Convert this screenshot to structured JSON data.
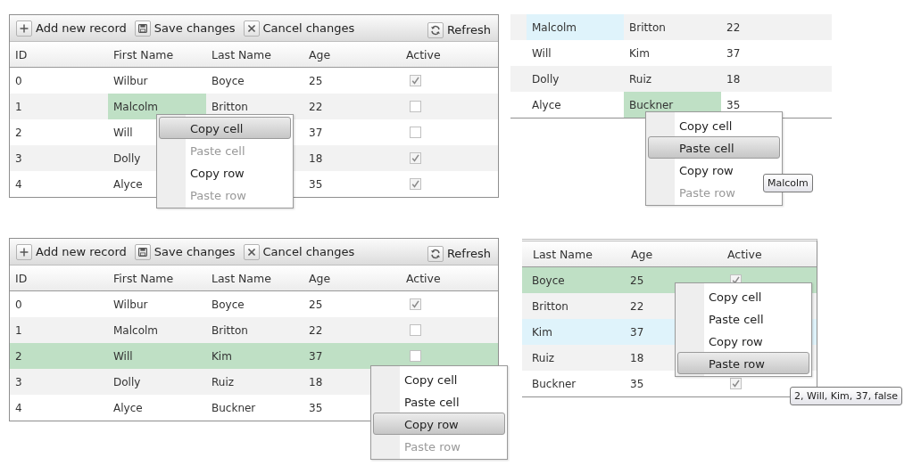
{
  "panels": [
    {
      "toolbar": [
        {
          "kind": "add",
          "label": "Add new record"
        },
        {
          "kind": "save",
          "label": "Save changes"
        },
        {
          "kind": "cancel",
          "label": "Cancel changes"
        },
        {
          "kind": "refresh",
          "label": "Refresh"
        }
      ],
      "columns": [
        "ID",
        "First Name",
        "Last Name",
        "Age",
        "Active"
      ],
      "rows": [
        {
          "selected": false,
          "id": "0",
          "first_name": "Wilbur",
          "last_name": "Boyce",
          "age": "25",
          "active": true
        },
        {
          "selected": false,
          "id": "1",
          "first_name": {
            "text": "Malcolm",
            "selected": true
          },
          "last_name": "Britton",
          "age": "22",
          "active": false
        },
        {
          "selected": false,
          "id": "2",
          "first_name": "Will",
          "age": "37",
          "active": false
        },
        {
          "selected": false,
          "id": "3",
          "first_name": "Dolly",
          "age": "18",
          "active": true
        },
        {
          "selected": false,
          "id": "4",
          "first_name": "Alyce",
          "age": "35",
          "active": true
        }
      ],
      "menu": {
        "items": [
          {
            "label": "Copy cell",
            "highlighted": true,
            "disabled": false
          },
          {
            "label": "Paste cell",
            "highlighted": false,
            "disabled": true
          },
          {
            "label": "Copy row",
            "highlighted": false,
            "disabled": false
          },
          {
            "label": "Paste row",
            "highlighted": false,
            "disabled": true
          }
        ]
      }
    },
    {
      "rows": [
        {
          "selected": false,
          "first_name": {
            "text": "Malcolm",
            "copied": true
          },
          "last_name": "Britton",
          "age": "22"
        },
        {
          "selected": false,
          "first_name": "Will",
          "last_name": "Kim",
          "age": "37"
        },
        {
          "selected": false,
          "first_name": "Dolly",
          "last_name": "Ruiz",
          "age": "18"
        },
        {
          "selected": false,
          "first_name": "Alyce",
          "last_name": {
            "text": "Buckner",
            "selected": true
          },
          "age": "35"
        }
      ],
      "menu": {
        "items": [
          {
            "label": "Copy cell",
            "highlighted": false,
            "disabled": false
          },
          {
            "label": "Paste cell",
            "highlighted": true,
            "disabled": false
          },
          {
            "label": "Copy row",
            "highlighted": false,
            "disabled": false
          },
          {
            "label": "Paste row",
            "highlighted": false,
            "disabled": true
          }
        ]
      },
      "tooltip": "Malcolm"
    },
    {
      "toolbar": [
        {
          "kind": "add",
          "label": "Add new record"
        },
        {
          "kind": "save",
          "label": "Save changes"
        },
        {
          "kind": "cancel",
          "label": "Cancel changes"
        },
        {
          "kind": "refresh",
          "label": "Refresh"
        }
      ],
      "columns": [
        "ID",
        "First Name",
        "Last Name",
        "Age",
        "Active"
      ],
      "rows": [
        {
          "selected": false,
          "id": "0",
          "first_name": "Wilbur",
          "last_name": "Boyce",
          "age": "25",
          "active": true
        },
        {
          "selected": false,
          "id": "1",
          "first_name": "Malcolm",
          "last_name": "Britton",
          "age": "22",
          "active": false
        },
        {
          "selected": true,
          "id": "2",
          "first_name": "Will",
          "last_name": "Kim",
          "age": "37",
          "active": false
        },
        {
          "selected": false,
          "id": "3",
          "first_name": "Dolly",
          "last_name": "Ruiz",
          "age": "18"
        },
        {
          "selected": false,
          "id": "4",
          "first_name": "Alyce",
          "last_name": "Buckner",
          "age": "35"
        }
      ],
      "menu": {
        "items": [
          {
            "label": "Copy cell",
            "highlighted": false,
            "disabled": false
          },
          {
            "label": "Paste cell",
            "highlighted": false,
            "disabled": false
          },
          {
            "label": "Copy row",
            "highlighted": true,
            "disabled": false
          },
          {
            "label": "Paste row",
            "highlighted": false,
            "disabled": true
          }
        ]
      }
    },
    {
      "columns": [
        "Last Name",
        "Age",
        "Active"
      ],
      "rows": [
        {
          "selected": true,
          "copied": false,
          "last_name": "Boyce",
          "age": "25",
          "active": true
        },
        {
          "selected": false,
          "copied": false,
          "last_name": "Britton",
          "age": "22"
        },
        {
          "selected": false,
          "copied": true,
          "last_name": "Kim",
          "age": "37"
        },
        {
          "selected": false,
          "copied": false,
          "last_name": "Ruiz",
          "age": "18"
        },
        {
          "selected": false,
          "copied": false,
          "last_name": "Buckner",
          "age": "35",
          "active": true
        }
      ],
      "menu": {
        "items": [
          {
            "label": "Copy cell",
            "highlighted": false,
            "disabled": false
          },
          {
            "label": "Paste cell",
            "highlighted": false,
            "disabled": false
          },
          {
            "label": "Copy row",
            "highlighted": false,
            "disabled": false
          },
          {
            "label": "Paste row",
            "highlighted": true,
            "disabled": false
          }
        ]
      },
      "tooltip": "2, Will, Kim, 37, false"
    }
  ]
}
